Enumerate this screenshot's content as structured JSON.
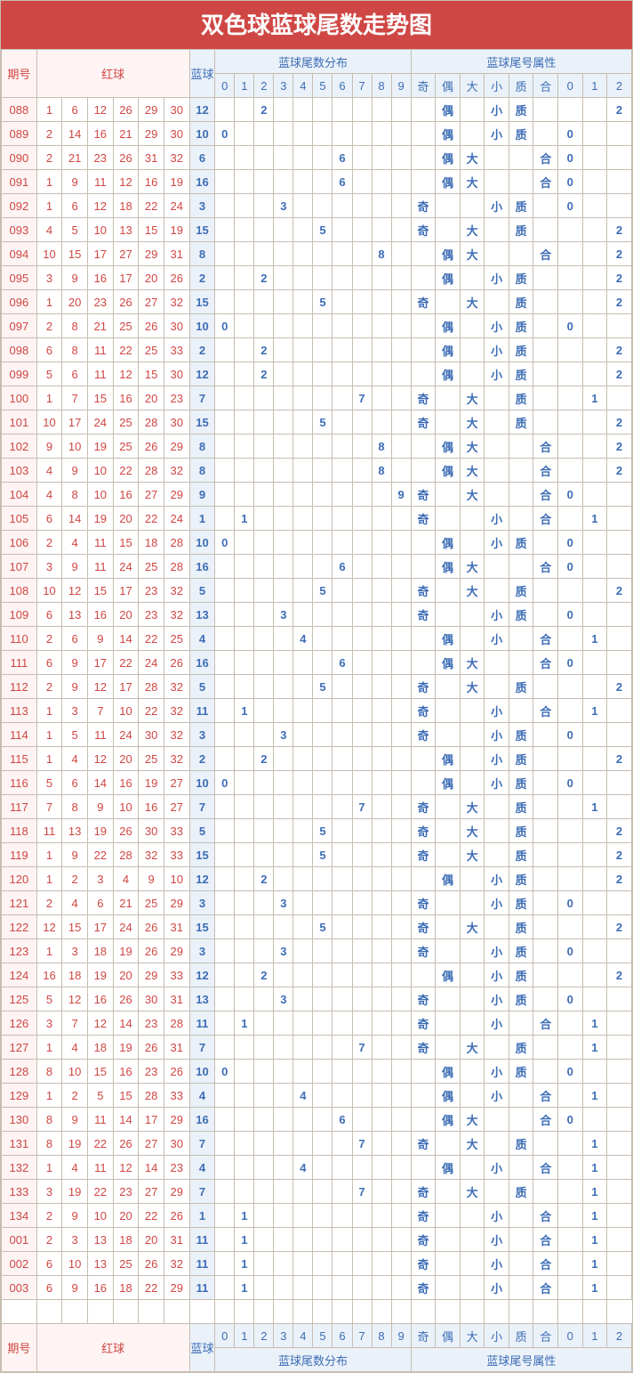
{
  "title": "双色球蓝球尾数走势图",
  "labels": {
    "period": "期号",
    "red": "红球",
    "blue": "蓝球",
    "dist": "蓝球尾数分布",
    "attr": "蓝球尾号属性"
  },
  "dist_cols": [
    "0",
    "1",
    "2",
    "3",
    "4",
    "5",
    "6",
    "7",
    "8",
    "9"
  ],
  "attr_cols": [
    "奇",
    "偶",
    "大",
    "小",
    "质",
    "合",
    "0",
    "1",
    "2"
  ],
  "chart_data": {
    "type": "table",
    "title": "双色球蓝球尾数走势图",
    "columns_dist": [
      "0",
      "1",
      "2",
      "3",
      "4",
      "5",
      "6",
      "7",
      "8",
      "9"
    ],
    "columns_attr": [
      "奇",
      "偶",
      "大",
      "小",
      "质",
      "合",
      "0",
      "1",
      "2"
    ],
    "periods": [
      "088",
      "089",
      "090",
      "091",
      "092",
      "093",
      "094",
      "095",
      "096",
      "097",
      "098",
      "099",
      "100",
      "101",
      "102",
      "103",
      "104",
      "105",
      "106",
      "107",
      "108",
      "109",
      "110",
      "111",
      "112",
      "113",
      "114",
      "115",
      "116",
      "117",
      "118",
      "119",
      "120",
      "121",
      "122",
      "123",
      "124",
      "125",
      "126",
      "127",
      "128",
      "129",
      "130",
      "131",
      "132",
      "133",
      "134",
      "001",
      "002",
      "003"
    ],
    "reds": [
      [
        1,
        6,
        12,
        26,
        29,
        30
      ],
      [
        2,
        14,
        16,
        21,
        29,
        30
      ],
      [
        2,
        21,
        23,
        26,
        31,
        32
      ],
      [
        1,
        9,
        11,
        12,
        16,
        19
      ],
      [
        1,
        6,
        12,
        18,
        22,
        24
      ],
      [
        4,
        5,
        10,
        13,
        15,
        19
      ],
      [
        10,
        15,
        17,
        27,
        29,
        31
      ],
      [
        3,
        9,
        16,
        17,
        20,
        26
      ],
      [
        1,
        20,
        23,
        26,
        27,
        32
      ],
      [
        2,
        8,
        21,
        25,
        26,
        30
      ],
      [
        6,
        8,
        11,
        22,
        25,
        33
      ],
      [
        5,
        6,
        11,
        12,
        15,
        30
      ],
      [
        1,
        7,
        15,
        16,
        20,
        23
      ],
      [
        10,
        17,
        24,
        25,
        28,
        30
      ],
      [
        9,
        10,
        19,
        25,
        26,
        29
      ],
      [
        4,
        9,
        10,
        22,
        28,
        32
      ],
      [
        4,
        8,
        10,
        16,
        27,
        29
      ],
      [
        6,
        14,
        19,
        20,
        22,
        24
      ],
      [
        2,
        4,
        11,
        15,
        18,
        28
      ],
      [
        3,
        9,
        11,
        24,
        25,
        28
      ],
      [
        10,
        12,
        15,
        17,
        23,
        32
      ],
      [
        6,
        13,
        16,
        20,
        23,
        32
      ],
      [
        2,
        6,
        9,
        14,
        22,
        25
      ],
      [
        6,
        9,
        17,
        22,
        24,
        26
      ],
      [
        2,
        9,
        12,
        17,
        28,
        32
      ],
      [
        1,
        3,
        7,
        10,
        22,
        32
      ],
      [
        1,
        5,
        11,
        24,
        30,
        32
      ],
      [
        1,
        4,
        12,
        20,
        25,
        32
      ],
      [
        5,
        6,
        14,
        16,
        19,
        27
      ],
      [
        7,
        8,
        9,
        10,
        16,
        27
      ],
      [
        11,
        13,
        19,
        26,
        30,
        33
      ],
      [
        1,
        9,
        22,
        28,
        32,
        33
      ],
      [
        1,
        2,
        3,
        4,
        9,
        10
      ],
      [
        2,
        4,
        6,
        21,
        25,
        29
      ],
      [
        12,
        15,
        17,
        24,
        26,
        31
      ],
      [
        1,
        3,
        18,
        19,
        26,
        29
      ],
      [
        16,
        18,
        19,
        20,
        29,
        33
      ],
      [
        5,
        12,
        16,
        26,
        30,
        31
      ],
      [
        3,
        7,
        12,
        14,
        23,
        28
      ],
      [
        1,
        4,
        18,
        19,
        26,
        31
      ],
      [
        8,
        10,
        15,
        16,
        23,
        26
      ],
      [
        1,
        2,
        5,
        15,
        28,
        33
      ],
      [
        8,
        9,
        11,
        14,
        17,
        29
      ],
      [
        8,
        19,
        22,
        26,
        27,
        30
      ],
      [
        1,
        4,
        11,
        12,
        14,
        23
      ],
      [
        3,
        19,
        22,
        23,
        27,
        29
      ],
      [
        2,
        9,
        10,
        20,
        22,
        26
      ],
      [
        2,
        3,
        13,
        18,
        20,
        31
      ],
      [
        6,
        10,
        13,
        25,
        26,
        32
      ],
      [
        6,
        9,
        16,
        18,
        22,
        29
      ]
    ],
    "blues": [
      12,
      10,
      6,
      16,
      3,
      15,
      8,
      2,
      15,
      10,
      2,
      12,
      7,
      15,
      8,
      8,
      9,
      1,
      10,
      16,
      5,
      13,
      4,
      16,
      5,
      11,
      3,
      2,
      10,
      7,
      5,
      15,
      12,
      3,
      15,
      3,
      12,
      13,
      11,
      7,
      10,
      4,
      16,
      7,
      4,
      7,
      1,
      11,
      11,
      11
    ],
    "dist": [
      [
        -1,
        -1,
        2,
        -1,
        -1,
        -1,
        -1,
        -1,
        -1,
        -1
      ],
      [
        0,
        -1,
        -1,
        -1,
        -1,
        -1,
        -1,
        -1,
        -1,
        -1
      ],
      [
        -1,
        -1,
        -1,
        -1,
        -1,
        -1,
        6,
        -1,
        -1,
        -1
      ],
      [
        -1,
        -1,
        -1,
        -1,
        -1,
        -1,
        6,
        -1,
        -1,
        -1
      ],
      [
        -1,
        -1,
        -1,
        3,
        -1,
        -1,
        -1,
        -1,
        -1,
        -1
      ],
      [
        -1,
        -1,
        -1,
        -1,
        -1,
        5,
        -1,
        -1,
        -1,
        -1
      ],
      [
        -1,
        -1,
        -1,
        -1,
        -1,
        -1,
        -1,
        -1,
        8,
        -1
      ],
      [
        -1,
        -1,
        2,
        -1,
        -1,
        -1,
        -1,
        -1,
        -1,
        -1
      ],
      [
        -1,
        -1,
        -1,
        -1,
        -1,
        5,
        -1,
        -1,
        -1,
        -1
      ],
      [
        0,
        -1,
        -1,
        -1,
        -1,
        -1,
        -1,
        -1,
        -1,
        -1
      ],
      [
        -1,
        -1,
        2,
        -1,
        -1,
        -1,
        -1,
        -1,
        -1,
        -1
      ],
      [
        -1,
        -1,
        2,
        -1,
        -1,
        -1,
        -1,
        -1,
        -1,
        -1
      ],
      [
        -1,
        -1,
        -1,
        -1,
        -1,
        -1,
        -1,
        7,
        -1,
        -1
      ],
      [
        -1,
        -1,
        -1,
        -1,
        -1,
        5,
        -1,
        -1,
        -1,
        -1
      ],
      [
        -1,
        -1,
        -1,
        -1,
        -1,
        -1,
        -1,
        -1,
        8,
        -1
      ],
      [
        -1,
        -1,
        -1,
        -1,
        -1,
        -1,
        -1,
        -1,
        8,
        -1
      ],
      [
        -1,
        -1,
        -1,
        -1,
        -1,
        -1,
        -1,
        -1,
        -1,
        9
      ],
      [
        -1,
        1,
        -1,
        -1,
        -1,
        -1,
        -1,
        -1,
        -1,
        -1
      ],
      [
        0,
        -1,
        -1,
        -1,
        -1,
        -1,
        -1,
        -1,
        -1,
        -1
      ],
      [
        -1,
        -1,
        -1,
        -1,
        -1,
        -1,
        6,
        -1,
        -1,
        -1
      ],
      [
        -1,
        -1,
        -1,
        -1,
        -1,
        5,
        -1,
        -1,
        -1,
        -1
      ],
      [
        -1,
        -1,
        -1,
        3,
        -1,
        -1,
        -1,
        -1,
        -1,
        -1
      ],
      [
        -1,
        -1,
        -1,
        -1,
        4,
        -1,
        -1,
        -1,
        -1,
        -1
      ],
      [
        -1,
        -1,
        -1,
        -1,
        -1,
        -1,
        6,
        -1,
        -1,
        -1
      ],
      [
        -1,
        -1,
        -1,
        -1,
        -1,
        5,
        -1,
        -1,
        -1,
        -1
      ],
      [
        -1,
        1,
        -1,
        -1,
        -1,
        -1,
        -1,
        -1,
        -1,
        -1
      ],
      [
        -1,
        -1,
        -1,
        3,
        -1,
        -1,
        -1,
        -1,
        -1,
        -1
      ],
      [
        -1,
        -1,
        2,
        -1,
        -1,
        -1,
        -1,
        -1,
        -1,
        -1
      ],
      [
        0,
        -1,
        -1,
        -1,
        -1,
        -1,
        -1,
        -1,
        -1,
        -1
      ],
      [
        -1,
        -1,
        -1,
        -1,
        -1,
        -1,
        -1,
        7,
        -1,
        -1
      ],
      [
        -1,
        -1,
        -1,
        -1,
        -1,
        5,
        -1,
        -1,
        -1,
        -1
      ],
      [
        -1,
        -1,
        -1,
        -1,
        -1,
        5,
        -1,
        -1,
        -1,
        -1
      ],
      [
        -1,
        -1,
        2,
        -1,
        -1,
        -1,
        -1,
        -1,
        -1,
        -1
      ],
      [
        -1,
        -1,
        -1,
        3,
        -1,
        -1,
        -1,
        -1,
        -1,
        -1
      ],
      [
        -1,
        -1,
        -1,
        -1,
        -1,
        5,
        -1,
        -1,
        -1,
        -1
      ],
      [
        -1,
        -1,
        -1,
        3,
        -1,
        -1,
        -1,
        -1,
        -1,
        -1
      ],
      [
        -1,
        -1,
        2,
        -1,
        -1,
        -1,
        -1,
        -1,
        -1,
        -1
      ],
      [
        -1,
        -1,
        -1,
        3,
        -1,
        -1,
        -1,
        -1,
        -1,
        -1
      ],
      [
        -1,
        1,
        -1,
        -1,
        -1,
        -1,
        -1,
        -1,
        -1,
        -1
      ],
      [
        -1,
        -1,
        -1,
        -1,
        -1,
        -1,
        -1,
        7,
        -1,
        -1
      ],
      [
        0,
        -1,
        -1,
        -1,
        -1,
        -1,
        -1,
        -1,
        -1,
        -1
      ],
      [
        -1,
        -1,
        -1,
        -1,
        4,
        -1,
        -1,
        -1,
        -1,
        -1
      ],
      [
        -1,
        -1,
        -1,
        -1,
        -1,
        -1,
        6,
        -1,
        -1,
        -1
      ],
      [
        -1,
        -1,
        -1,
        -1,
        -1,
        -1,
        -1,
        7,
        -1,
        -1
      ],
      [
        -1,
        -1,
        -1,
        -1,
        4,
        -1,
        -1,
        -1,
        -1,
        -1
      ],
      [
        -1,
        -1,
        -1,
        -1,
        -1,
        -1,
        -1,
        7,
        -1,
        -1
      ],
      [
        -1,
        1,
        -1,
        -1,
        -1,
        -1,
        -1,
        -1,
        -1,
        -1
      ],
      [
        -1,
        1,
        -1,
        -1,
        -1,
        -1,
        -1,
        -1,
        -1,
        -1
      ],
      [
        -1,
        1,
        -1,
        -1,
        -1,
        -1,
        -1,
        -1,
        -1,
        -1
      ],
      [
        -1,
        1,
        -1,
        -1,
        -1,
        -1,
        -1,
        -1,
        -1,
        -1
      ]
    ],
    "attr": [
      [
        "",
        "偶",
        "",
        "小",
        "质",
        "",
        "",
        "",
        "2"
      ],
      [
        "",
        "偶",
        "",
        "小",
        "质",
        "",
        "0",
        "",
        ""
      ],
      [
        "",
        "偶",
        "大",
        "",
        "",
        "合",
        "0",
        "",
        ""
      ],
      [
        "",
        "偶",
        "大",
        "",
        "",
        "合",
        "0",
        "",
        ""
      ],
      [
        "奇",
        "",
        "",
        "小",
        "质",
        "",
        "0",
        "",
        ""
      ],
      [
        "奇",
        "",
        "大",
        "",
        "质",
        "",
        "",
        "",
        "2"
      ],
      [
        "",
        "偶",
        "大",
        "",
        "",
        "合",
        "",
        "",
        "2"
      ],
      [
        "",
        "偶",
        "",
        "小",
        "质",
        "",
        "",
        "",
        "2"
      ],
      [
        "奇",
        "",
        "大",
        "",
        "质",
        "",
        "",
        "",
        "2"
      ],
      [
        "",
        "偶",
        "",
        "小",
        "质",
        "",
        "0",
        "",
        ""
      ],
      [
        "",
        "偶",
        "",
        "小",
        "质",
        "",
        "",
        "",
        "2"
      ],
      [
        "",
        "偶",
        "",
        "小",
        "质",
        "",
        "",
        "",
        "2"
      ],
      [
        "奇",
        "",
        "大",
        "",
        "质",
        "",
        "",
        "1",
        ""
      ],
      [
        "奇",
        "",
        "大",
        "",
        "质",
        "",
        "",
        "",
        "2"
      ],
      [
        "",
        "偶",
        "大",
        "",
        "",
        "合",
        "",
        "",
        "2"
      ],
      [
        "",
        "偶",
        "大",
        "",
        "",
        "合",
        "",
        "",
        "2"
      ],
      [
        "奇",
        "",
        "大",
        "",
        "",
        "合",
        "0",
        "",
        ""
      ],
      [
        "奇",
        "",
        "",
        "小",
        "",
        "合",
        "",
        "1",
        ""
      ],
      [
        "",
        "偶",
        "",
        "小",
        "质",
        "",
        "0",
        "",
        ""
      ],
      [
        "",
        "偶",
        "大",
        "",
        "",
        "合",
        "0",
        "",
        ""
      ],
      [
        "奇",
        "",
        "大",
        "",
        "质",
        "",
        "",
        "",
        "2"
      ],
      [
        "奇",
        "",
        "",
        "小",
        "质",
        "",
        "0",
        "",
        ""
      ],
      [
        "",
        "偶",
        "",
        "小",
        "",
        "合",
        "",
        "1",
        ""
      ],
      [
        "",
        "偶",
        "大",
        "",
        "",
        "合",
        "0",
        "",
        ""
      ],
      [
        "奇",
        "",
        "大",
        "",
        "质",
        "",
        "",
        "",
        "2"
      ],
      [
        "奇",
        "",
        "",
        "小",
        "",
        "合",
        "",
        "1",
        ""
      ],
      [
        "奇",
        "",
        "",
        "小",
        "质",
        "",
        "0",
        "",
        ""
      ],
      [
        "",
        "偶",
        "",
        "小",
        "质",
        "",
        "",
        "",
        "2"
      ],
      [
        "",
        "偶",
        "",
        "小",
        "质",
        "",
        "0",
        "",
        ""
      ],
      [
        "奇",
        "",
        "大",
        "",
        "质",
        "",
        "",
        "1",
        ""
      ],
      [
        "奇",
        "",
        "大",
        "",
        "质",
        "",
        "",
        "",
        "2"
      ],
      [
        "奇",
        "",
        "大",
        "",
        "质",
        "",
        "",
        "",
        "2"
      ],
      [
        "",
        "偶",
        "",
        "小",
        "质",
        "",
        "",
        "",
        "2"
      ],
      [
        "奇",
        "",
        "",
        "小",
        "质",
        "",
        "0",
        "",
        ""
      ],
      [
        "奇",
        "",
        "大",
        "",
        "质",
        "",
        "",
        "",
        "2"
      ],
      [
        "奇",
        "",
        "",
        "小",
        "质",
        "",
        "0",
        "",
        ""
      ],
      [
        "",
        "偶",
        "",
        "小",
        "质",
        "",
        "",
        "",
        "2"
      ],
      [
        "奇",
        "",
        "",
        "小",
        "质",
        "",
        "0",
        "",
        ""
      ],
      [
        "奇",
        "",
        "",
        "小",
        "",
        "合",
        "",
        "1",
        ""
      ],
      [
        "奇",
        "",
        "大",
        "",
        "质",
        "",
        "",
        "1",
        ""
      ],
      [
        "",
        "偶",
        "",
        "小",
        "质",
        "",
        "0",
        "",
        ""
      ],
      [
        "",
        "偶",
        "",
        "小",
        "",
        "合",
        "",
        "1",
        ""
      ],
      [
        "",
        "偶",
        "大",
        "",
        "",
        "合",
        "0",
        "",
        ""
      ],
      [
        "奇",
        "",
        "大",
        "",
        "质",
        "",
        "",
        "1",
        ""
      ],
      [
        "",
        "偶",
        "",
        "小",
        "",
        "合",
        "",
        "1",
        ""
      ],
      [
        "奇",
        "",
        "大",
        "",
        "质",
        "",
        "",
        "1",
        ""
      ],
      [
        "奇",
        "",
        "",
        "小",
        "",
        "合",
        "",
        "1",
        ""
      ],
      [
        "奇",
        "",
        "",
        "小",
        "",
        "合",
        "",
        "1",
        ""
      ],
      [
        "奇",
        "",
        "",
        "小",
        "",
        "合",
        "",
        "1",
        ""
      ],
      [
        "奇",
        "",
        "",
        "小",
        "",
        "合",
        "",
        "1",
        ""
      ]
    ]
  }
}
